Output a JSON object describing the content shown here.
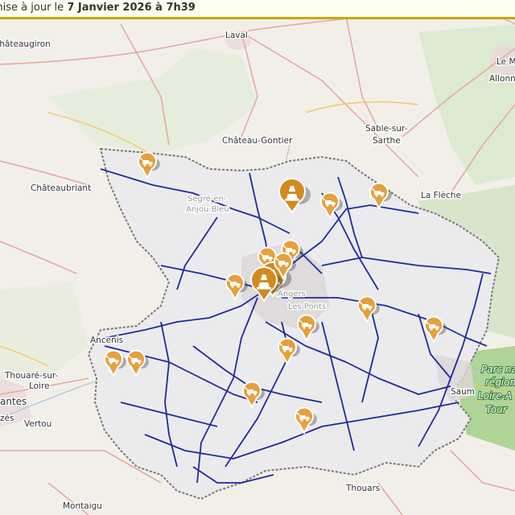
{
  "banner": {
    "prefix": "mise à jour le ",
    "date": "7 Janvier 2026 à 7h39"
  },
  "towns": {
    "laval": "Laval",
    "chateaugiron": "Châteaugiron",
    "le_mans": "Le M",
    "allonnes": "Allonne",
    "chateau_gontier": "Château-Gontier",
    "sable_l1": "Sable-sur-",
    "sable_l2": "Sarthe",
    "chateaubriant": "Châteaubriant",
    "la_fleche": "La Flèche",
    "segre_l1": "Segré-en-",
    "segre_l2": "Anjou Bleu",
    "angers": "Angers",
    "les_ponts": "Les Ponts",
    "ancenis": "Ancenis",
    "thouare_l1": "Thouaré-sur-",
    "thouare_l2": "Loire",
    "nantes": "antes",
    "rezes": "zés",
    "vertou": "Vertou",
    "saumur": "Saum",
    "thouars": "Thouars",
    "montaigu": "Montaigu",
    "park_l1": "Parc na",
    "park_l2": "région",
    "park_l3": "Loire-A",
    "park_l4": "Tour"
  },
  "markers": [
    {
      "name": "roadwork-marker",
      "size": "small"
    },
    {
      "name": "roadwork-marker",
      "size": "large"
    },
    {
      "name": "roadwork-marker",
      "size": "small"
    },
    {
      "name": "roadwork-marker",
      "size": "small"
    },
    {
      "name": "roadwork-marker",
      "size": "small"
    },
    {
      "name": "roadwork-marker",
      "size": "small"
    },
    {
      "name": "roadwork-marker",
      "size": "large"
    },
    {
      "name": "roadwork-marker",
      "size": "large"
    },
    {
      "name": "roadwork-marker",
      "size": "small"
    },
    {
      "name": "roadwork-marker",
      "size": "small"
    },
    {
      "name": "roadwork-marker",
      "size": "small"
    },
    {
      "name": "roadwork-marker",
      "size": "small"
    },
    {
      "name": "roadwork-marker",
      "size": "small"
    },
    {
      "name": "roadwork-marker",
      "size": "small"
    },
    {
      "name": "roadwork-marker",
      "size": "small"
    },
    {
      "name": "roadwork-marker",
      "size": "small"
    },
    {
      "name": "roadwork-marker",
      "size": "small"
    },
    {
      "name": "roadwork-marker",
      "size": "small"
    }
  ],
  "colors": {
    "marker_fill": "#e6a03c",
    "marker_large_fill": "#d18a20",
    "route_color": "#1f2a9c",
    "department_fill": "#ebebee",
    "banner_border": "#c9a800"
  },
  "icons": {
    "small_marker": "roadwork-truck-icon",
    "large_marker": "traffic-cone-icon"
  }
}
